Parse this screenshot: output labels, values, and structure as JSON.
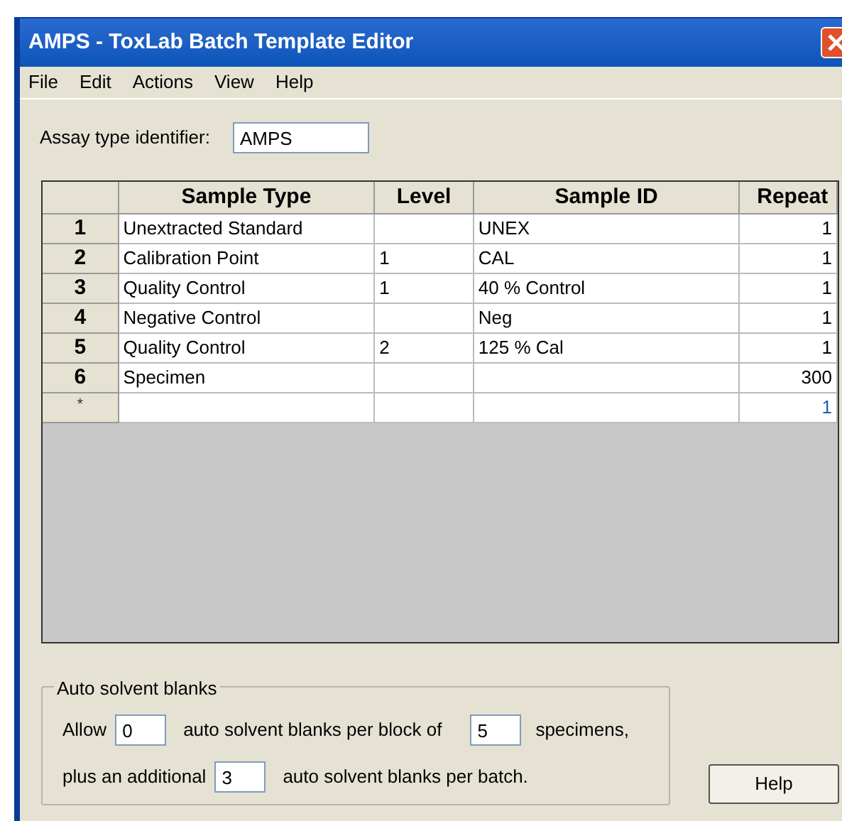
{
  "window": {
    "title": "AMPS - ToxLab Batch Template Editor"
  },
  "menu": [
    "File",
    "Edit",
    "Actions",
    "View",
    "Help"
  ],
  "assay": {
    "label": "Assay type identifier:",
    "value": "AMPS"
  },
  "table": {
    "columns": [
      "Sample Type",
      "Level",
      "Sample ID",
      "Repeat"
    ],
    "rows": [
      {
        "header": "1",
        "cells": [
          "Unextracted Standard",
          "",
          "UNEX",
          "1"
        ]
      },
      {
        "header": "2",
        "cells": [
          "Calibration Point",
          "1",
          "CAL",
          "1"
        ]
      },
      {
        "header": "3",
        "cells": [
          "Quality Control",
          "1",
          "40 % Control",
          "1"
        ]
      },
      {
        "header": "4",
        "cells": [
          "Negative Control",
          "",
          "Neg",
          "1"
        ]
      },
      {
        "header": "5",
        "cells": [
          "Quality Control",
          "2",
          "125 % Cal",
          "1"
        ]
      },
      {
        "header": "6",
        "cells": [
          "Specimen",
          "",
          "",
          "300"
        ]
      },
      {
        "header": "*",
        "new": true,
        "cells": [
          "",
          "",
          "",
          "1"
        ]
      }
    ]
  },
  "blanks": {
    "title": "Auto solvent blanks",
    "allow": "Allow",
    "allow_value": "0",
    "per_block": "auto solvent blanks per block of",
    "block_value": "5",
    "specimens": "specimens,",
    "plus": "plus an additional",
    "additional_value": "3",
    "per_batch": "auto solvent blanks per batch."
  },
  "help_button": "Help"
}
